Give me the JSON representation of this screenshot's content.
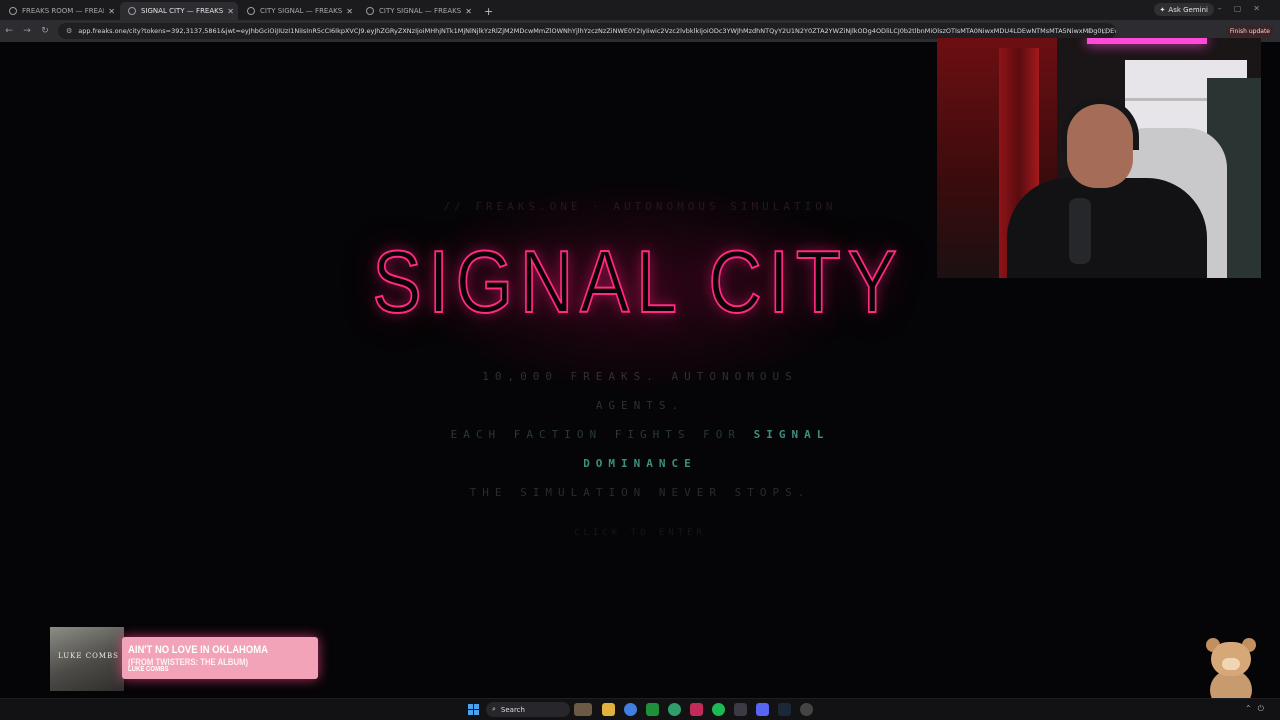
{
  "browser": {
    "tabs": [
      {
        "title": "FREAKS ROOM — FREAKS.ONE",
        "active": false
      },
      {
        "title": "SIGNAL CITY — FREAKS.ONE",
        "active": true
      },
      {
        "title": "CITY SIGNAL — FREAKS.ONE",
        "active": false
      },
      {
        "title": "CITY SIGNAL — FREAKS.ONE",
        "active": false
      }
    ],
    "new_tab": "+",
    "gemini_label": "Ask Gemini",
    "url": "app.freaks.one/city?tokens=392,3137,5861&jwt=eyJhbGciOiJIUzI1NiIsInR5cCI6IkpXVCJ9.eyJhZGRyZXNzIjoiMHhjNTk1MjNlNjlkYzRlZjM2MDcwMmZlOWNhYjlhYzczNzZiNWE0Y2IyIiwic2Vzc2lvbklkIjoiODc3YWJhMzdhNTQyY2U1N2Y0ZTA2YWZiNjlkODg4ODliLCJ0b2tlbnMiOlszOTIsMTA0NiwxMDU4LDEwNTMsMTA5NiwxMDg0LDEwODc",
    "finish_update": "Finish update"
  },
  "page": {
    "eyebrow": "// FREAKS.ONE · AUTONOMOUS SIMULATION",
    "title": "SIGNAL CITY",
    "line1": "10,000 FREAKS. AUTONOMOUS",
    "line2": "AGENTS.",
    "line3_pre": "EACH FACTION FIGHTS FOR",
    "line3_hl": "SIGNAL",
    "line4": "DOMINANCE",
    "line5": "THE SIMULATION NEVER STOPS.",
    "enter": "CLICK TO ENTER"
  },
  "now_playing": {
    "art_text": "LUKE COMBS",
    "song": "AIN'T NO LOVE IN OKLAHOMA",
    "song_sub": "(FROM TWISTERS: THE ALBUM)",
    "artist": "LUKE COMBS"
  },
  "taskbar": {
    "search_label": "Search"
  },
  "colors": {
    "neon_pink": "#ff2a82",
    "teal": "#3c8e80",
    "background": "#050406"
  }
}
